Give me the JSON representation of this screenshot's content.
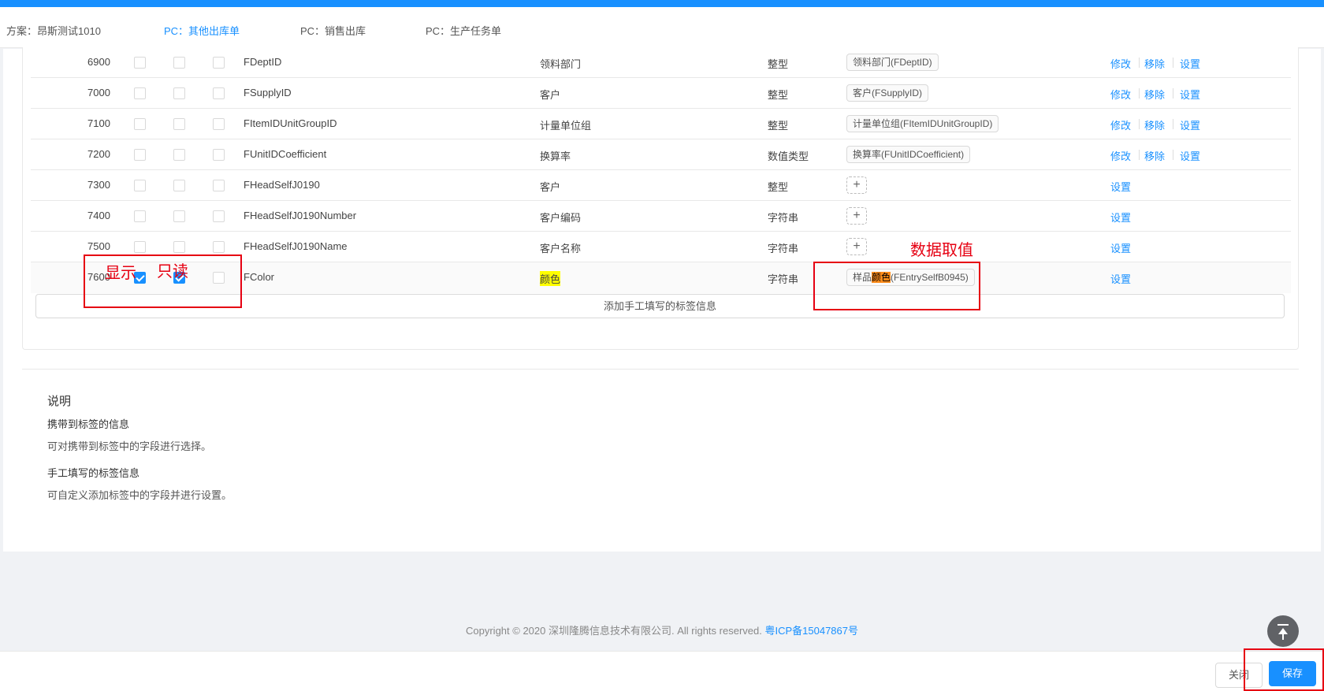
{
  "tabs": [
    {
      "label": "方案：昂斯测试1010"
    },
    {
      "label": "PC：其他出库单"
    },
    {
      "label": "PC：销售出库"
    },
    {
      "label": "PC：生产任务单"
    }
  ],
  "rows": [
    {
      "seq": "6900",
      "show": false,
      "readonly": false,
      "col3": false,
      "field": "FDeptID",
      "name": "领料部门",
      "type": "整型",
      "tag": "领料部门(FDeptID)",
      "actions": [
        "修改",
        "移除",
        "设置"
      ]
    },
    {
      "seq": "7000",
      "show": false,
      "readonly": false,
      "col3": false,
      "field": "FSupplyID",
      "name": "客户",
      "type": "整型",
      "tag": "客户(FSupplyID)",
      "actions": [
        "修改",
        "移除",
        "设置"
      ]
    },
    {
      "seq": "7100",
      "show": false,
      "readonly": false,
      "col3": false,
      "field": "FItemIDUnitGroupID",
      "name": "计量单位组",
      "type": "整型",
      "tag": "计量单位组(FItemIDUnitGroupID)",
      "actions": [
        "修改",
        "移除",
        "设置"
      ]
    },
    {
      "seq": "7200",
      "show": false,
      "readonly": false,
      "col3": false,
      "field": "FUnitIDCoefficient",
      "name": "换算率",
      "type": "数值类型",
      "tag": "换算率(FUnitIDCoefficient)",
      "actions": [
        "修改",
        "移除",
        "设置"
      ]
    },
    {
      "seq": "7300",
      "show": false,
      "readonly": false,
      "col3": false,
      "field": "FHeadSelfJ0190",
      "name": "客户",
      "type": "整型",
      "tag": "",
      "actions": [
        "设置"
      ]
    },
    {
      "seq": "7400",
      "show": false,
      "readonly": false,
      "col3": false,
      "field": "FHeadSelfJ0190Number",
      "name": "客户编码",
      "type": "字符串",
      "tag": "",
      "actions": [
        "设置"
      ]
    },
    {
      "seq": "7500",
      "show": false,
      "readonly": false,
      "col3": false,
      "field": "FHeadSelfJ0190Name",
      "name": "客户名称",
      "type": "字符串",
      "tag": "",
      "actions": [
        "设置"
      ]
    },
    {
      "seq": "7600",
      "show": true,
      "readonly": true,
      "col3": false,
      "field": "FColor",
      "name": "颜色",
      "type": "字符串",
      "tag_prefix": "样品",
      "tag_highlight": "颜色",
      "tag_suffix": "(FEntrySelfB0945)",
      "actions": [
        "设置"
      ]
    }
  ],
  "add_button": "添加手工填写的标签信息",
  "description": {
    "title": "说明",
    "section1_title": "携带到标签的信息",
    "section1_text": "可对携带到标签中的字段进行选择。",
    "section2_title": "手工填写的标签信息",
    "section2_text": "可自定义添加标签中的字段并进行设置。"
  },
  "footer": {
    "copyright": "Copyright © 2020 深圳隆腾信息技术有限公司. All rights reserved.",
    "icp": "粤ICP备15047867号"
  },
  "buttons": {
    "close": "关闭",
    "save": "保存"
  },
  "annotations": {
    "show": "显示",
    "readonly": "只读",
    "data_value": "数据取值"
  },
  "colors": {
    "accent": "#1890ff",
    "annotation": "#e60012",
    "highlight_yellow": "#ffff00",
    "highlight_orange": "#ff8c1a"
  },
  "icons": {
    "plus": "plus-icon",
    "back_to_top": "back-to-top-icon",
    "check": "check-icon"
  }
}
